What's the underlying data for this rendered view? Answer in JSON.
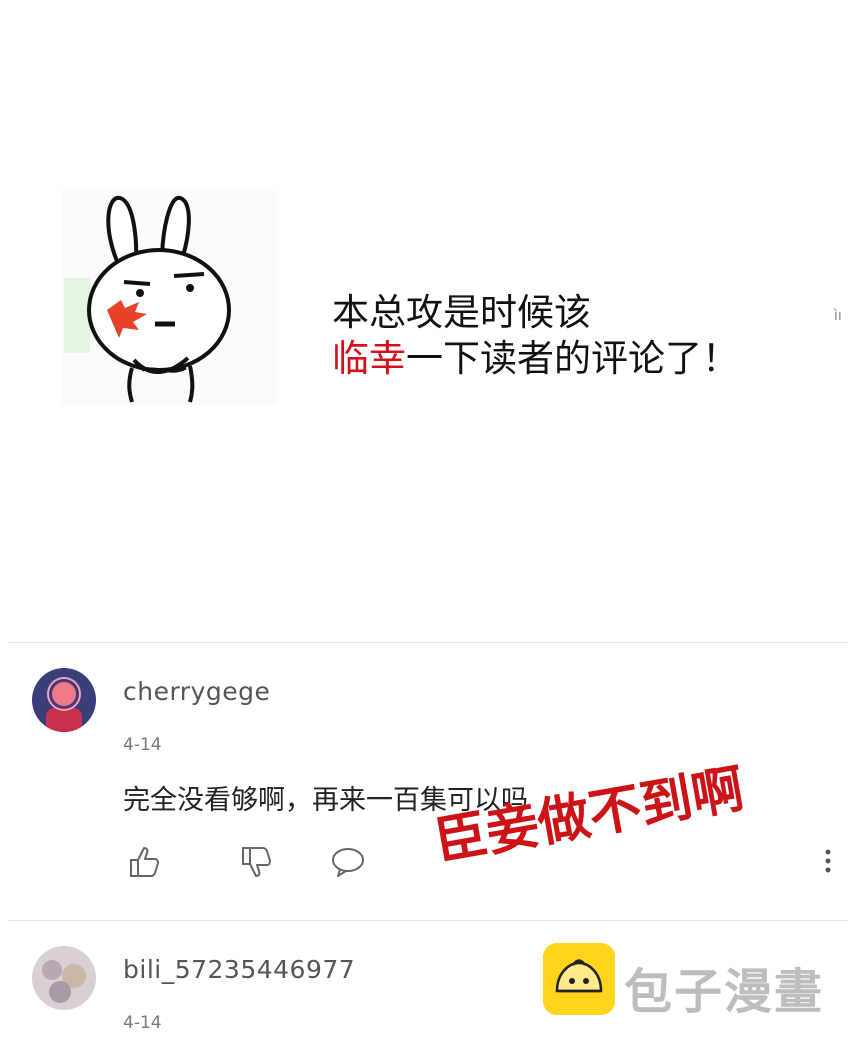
{
  "banner": {
    "line1": "本总攻是时候该",
    "line2_red": "临幸",
    "line2_rest": "一下读者的评论了！",
    "edge_mark": "ìı"
  },
  "comments": [
    {
      "username": "cherrygege",
      "date": "4-14",
      "text": "完全没看够啊，再来一百集可以吗",
      "icons": [
        "thumbs-up-icon",
        "thumbs-down-icon",
        "reply-bubble-icon",
        "more-icon"
      ]
    },
    {
      "username": "bili_57235446977",
      "date": "4-14"
    }
  ],
  "overlay_text": "臣妾做不到啊",
  "watermark": {
    "brand": "包子漫畫"
  },
  "colors": {
    "accent_red": "#d3101b",
    "logo_yellow": "#ffd41c"
  }
}
